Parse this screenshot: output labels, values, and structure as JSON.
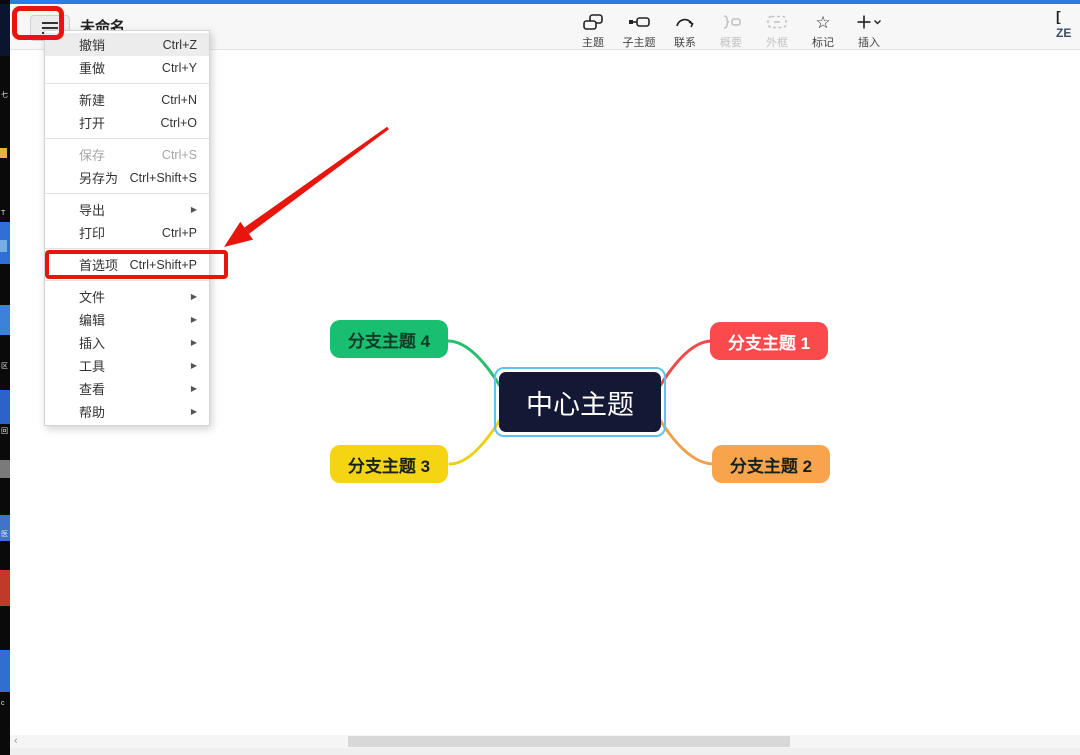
{
  "app": {
    "window_title": "未命名",
    "corner_badge_text": "ZE",
    "corner_badge_icon": "[ ",
    "top_edge_color": "#2b7de1"
  },
  "toolbar": {
    "items": [
      {
        "label": "主题",
        "icon": "topic-icon",
        "disabled": false
      },
      {
        "label": "子主题",
        "icon": "subtopic-icon",
        "disabled": false
      },
      {
        "label": "联系",
        "icon": "relationship-icon",
        "disabled": false
      },
      {
        "label": "概要",
        "icon": "summary-icon",
        "disabled": true
      },
      {
        "label": "外框",
        "icon": "boundary-icon",
        "disabled": true
      },
      {
        "label": "标记",
        "icon": "marker-icon",
        "disabled": false
      },
      {
        "label": "插入",
        "icon": "insert-icon",
        "disabled": false
      }
    ],
    "marker_star_glyph": "☆"
  },
  "menu": {
    "items": [
      {
        "label": "撤销",
        "right": "Ctrl+Z"
      },
      {
        "label": "重做",
        "right": "Ctrl+Y"
      },
      {
        "label": "新建",
        "right": "Ctrl+N"
      },
      {
        "label": "打开",
        "right": "Ctrl+O"
      },
      {
        "label": "保存",
        "right": "Ctrl+S"
      },
      {
        "label": "另存为",
        "right": "Ctrl+Shift+S"
      },
      {
        "label": "导出",
        "right": "▶"
      },
      {
        "label": "打印",
        "right": "Ctrl+P"
      },
      {
        "label": "首选项",
        "right": "Ctrl+Shift+P"
      },
      {
        "label": "文件",
        "right": "▶"
      },
      {
        "label": "编辑",
        "right": "▶"
      },
      {
        "label": "插入",
        "right": "▶"
      },
      {
        "label": "工具",
        "right": "▶"
      },
      {
        "label": "查看",
        "right": "▶"
      },
      {
        "label": "帮助",
        "right": "▶"
      }
    ]
  },
  "mindmap": {
    "central": {
      "label": "中心主题",
      "bg": "#131834",
      "text_color": "#ffffff",
      "selection_color": "#5ec2f2"
    },
    "branches": [
      {
        "label": "分支主题 1",
        "bg": "#fb4a4c",
        "text_color": "#ffffff",
        "line_color": "#ef4b4b"
      },
      {
        "label": "分支主题 2",
        "bg": "#f7a44d",
        "text_color": "#16211c",
        "line_color": "#efa04c"
      },
      {
        "label": "分支主题 3",
        "bg": "#f5d413",
        "text_color": "#16211c",
        "line_color": "#edd012"
      },
      {
        "label": "分支主题 4",
        "bg": "#19bf70",
        "text_color": "#0f3a26",
        "line_color": "#27be70"
      }
    ]
  },
  "annotations": {
    "color": "#e8150d"
  },
  "background_strip": {
    "glyphs": [
      "七",
      "T",
      "区",
      "回",
      "医",
      "c"
    ]
  },
  "scrollbar": {
    "left_arrow_glyph": "‹"
  }
}
